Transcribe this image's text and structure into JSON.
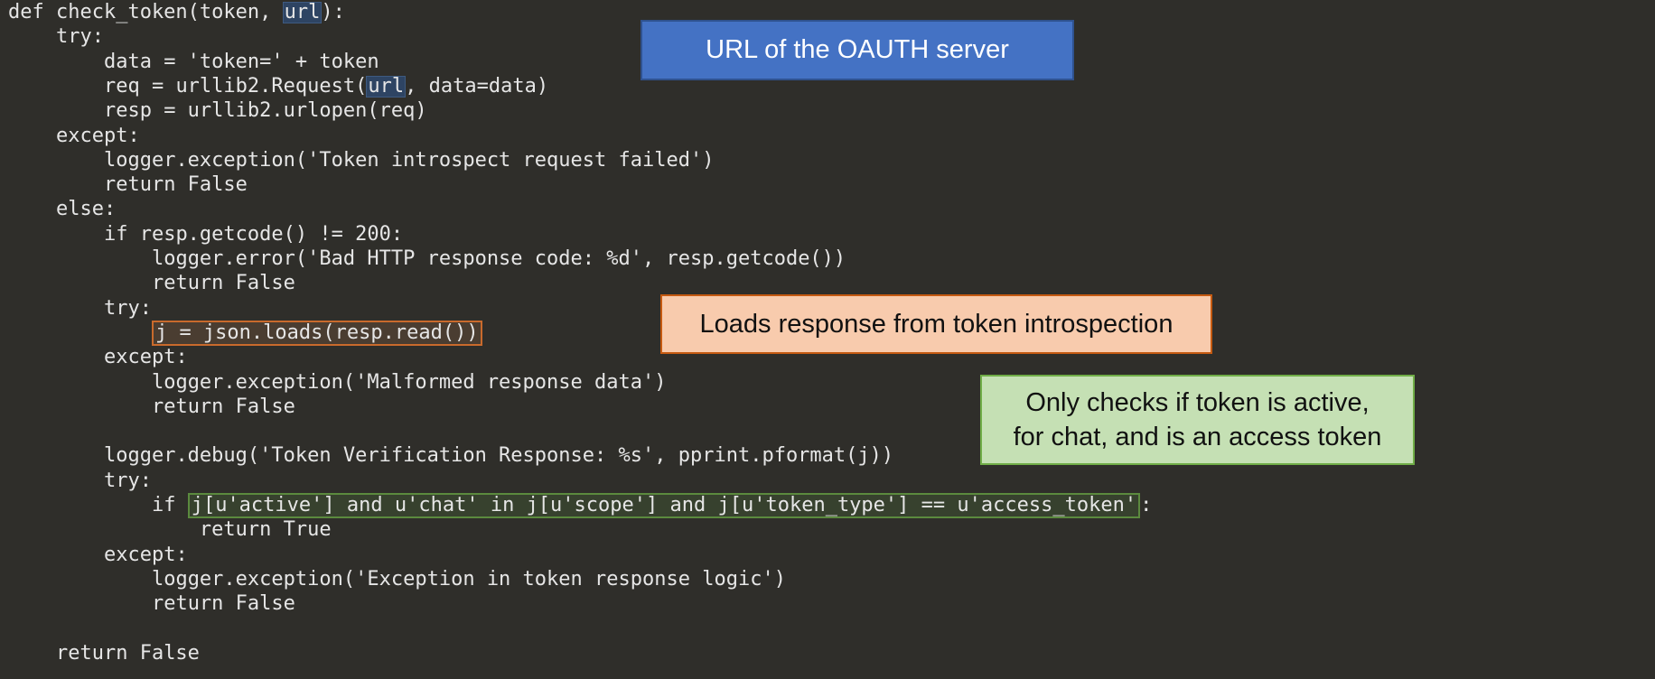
{
  "code": {
    "language": "python",
    "lines": [
      {
        "indent": "",
        "segments": [
          {
            "text": "def check_token(token, "
          },
          {
            "text": "url",
            "highlight": "url"
          },
          {
            "text": "):"
          }
        ]
      },
      {
        "indent": "    ",
        "segments": [
          {
            "text": "try:"
          }
        ]
      },
      {
        "indent": "        ",
        "segments": [
          {
            "text": "data = 'token=' + token"
          }
        ]
      },
      {
        "indent": "        ",
        "segments": [
          {
            "text": "req = urllib2.Request("
          },
          {
            "text": "url",
            "highlight": "url"
          },
          {
            "text": ", data=data)"
          }
        ]
      },
      {
        "indent": "        ",
        "segments": [
          {
            "text": "resp = urllib2.urlopen(req)"
          }
        ]
      },
      {
        "indent": "    ",
        "segments": [
          {
            "text": "except:"
          }
        ]
      },
      {
        "indent": "        ",
        "segments": [
          {
            "text": "logger.exception('Token introspect request failed')"
          }
        ]
      },
      {
        "indent": "        ",
        "segments": [
          {
            "text": "return False"
          }
        ]
      },
      {
        "indent": "    ",
        "segments": [
          {
            "text": "else:"
          }
        ]
      },
      {
        "indent": "        ",
        "segments": [
          {
            "text": "if resp.getcode() != 200:"
          }
        ]
      },
      {
        "indent": "            ",
        "segments": [
          {
            "text": "logger.error('Bad HTTP response code: %d', resp.getcode())"
          }
        ]
      },
      {
        "indent": "            ",
        "segments": [
          {
            "text": "return False"
          }
        ]
      },
      {
        "indent": "        ",
        "segments": [
          {
            "text": "try:"
          }
        ]
      },
      {
        "indent": "            ",
        "segments": [
          {
            "text": "j = json.loads(resp.read())",
            "highlight": "orange"
          }
        ]
      },
      {
        "indent": "        ",
        "segments": [
          {
            "text": "except:"
          }
        ]
      },
      {
        "indent": "            ",
        "segments": [
          {
            "text": "logger.exception('Malformed response data')"
          }
        ]
      },
      {
        "indent": "            ",
        "segments": [
          {
            "text": "return False"
          }
        ]
      },
      {
        "indent": "",
        "segments": []
      },
      {
        "indent": "        ",
        "segments": [
          {
            "text": "logger.debug('Token Verification Response: %s', pprint.pformat(j))"
          }
        ]
      },
      {
        "indent": "        ",
        "segments": [
          {
            "text": "try:"
          }
        ]
      },
      {
        "indent": "            ",
        "segments": [
          {
            "text": "if "
          },
          {
            "text": "j[u'active'] and u'chat' in j[u'scope'] and j[u'token_type'] == u'access_token'",
            "highlight": "green"
          },
          {
            "text": ":"
          }
        ]
      },
      {
        "indent": "                ",
        "segments": [
          {
            "text": "return True"
          }
        ]
      },
      {
        "indent": "        ",
        "segments": [
          {
            "text": "except:"
          }
        ]
      },
      {
        "indent": "            ",
        "segments": [
          {
            "text": "logger.exception('Exception in token response logic')"
          }
        ]
      },
      {
        "indent": "            ",
        "segments": [
          {
            "text": "return False"
          }
        ]
      },
      {
        "indent": "",
        "segments": []
      },
      {
        "indent": "    ",
        "segments": [
          {
            "text": "return False"
          }
        ]
      }
    ]
  },
  "callouts": {
    "oauth_url": "URL of the OAUTH server",
    "loads_response": "Loads response from token introspection",
    "checks_line1": "Only checks if token is active,",
    "checks_line2": "for chat, and is an access token"
  },
  "colors": {
    "background": "#2f2e2a",
    "code_text": "#e6e6e6",
    "blue_callout": "#4472c4",
    "orange_callout": "#f8cbad",
    "green_callout": "#c5e0b4"
  }
}
